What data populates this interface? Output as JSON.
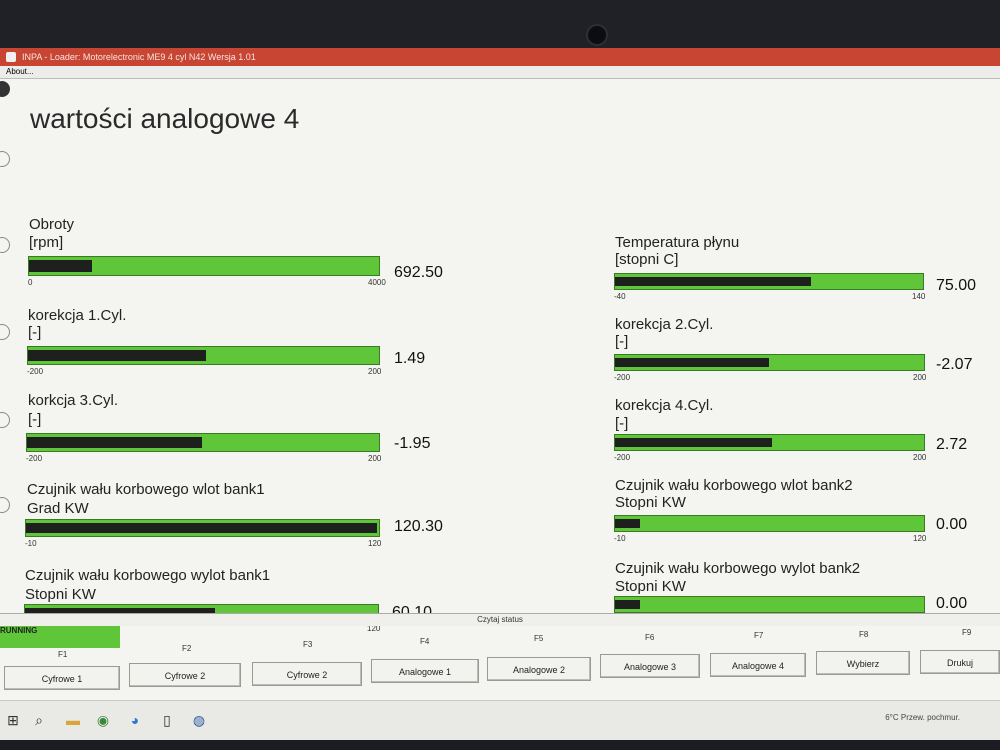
{
  "window": {
    "title": "INPA - Loader: Motorelectronic ME9  4 cyl N42 Wersja 1.01",
    "menu_about": "About..."
  },
  "page": {
    "title": "wartości analogowe 4"
  },
  "gauges": [
    {
      "name": "obroty",
      "label1": "Obroty",
      "label2": "[rpm]",
      "min": "0",
      "max": "4000",
      "value_text": "692.50",
      "fill": 0.18
    },
    {
      "name": "korekcja-1",
      "label1": "korekcja 1.Cyl.",
      "label2": "[-]",
      "min": "-200",
      "max": "200",
      "value_text": "1.49",
      "fill": 0.51
    },
    {
      "name": "korekcja-3",
      "label1": "korkcja 3.Cyl.",
      "label2": "[-]",
      "min": "-200",
      "max": "200",
      "value_text": "-1.95",
      "fill": 0.5
    },
    {
      "name": "wlot-bank1",
      "label1": "Czujnik wału korbowego wlot bank1",
      "label2": "Grad KW",
      "min": "-10",
      "max": "120",
      "value_text": "120.30",
      "fill": 1.0
    },
    {
      "name": "wylot-bank1",
      "label1": "Czujnik wału korbowego wylot bank1",
      "label2": "Stopni KW",
      "min": "-10",
      "max": "120",
      "value_text": "60.10",
      "fill": 0.54
    },
    {
      "name": "temperatura",
      "label1": "Temperatura płynu",
      "label2": "[stopni C]",
      "min": "-40",
      "max": "140",
      "value_text": "75.00",
      "fill": 0.64
    },
    {
      "name": "korekcja-2",
      "label1": "korekcja 2.Cyl.",
      "label2": "[-]",
      "min": "-200",
      "max": "200",
      "value_text": "-2.07",
      "fill": 0.5
    },
    {
      "name": "korekcja-4",
      "label1": "korekcja 4.Cyl.",
      "label2": "[-]",
      "min": "-200",
      "max": "200",
      "value_text": "2.72",
      "fill": 0.51
    },
    {
      "name": "wlot-bank2",
      "label1": "Czujnik wału korbowego wlot bank2",
      "label2": "Stopni KW",
      "min": "-10",
      "max": "120",
      "value_text": "0.00",
      "fill": 0.08
    },
    {
      "name": "wylot-bank2",
      "label1": "Czujnik wału korbowego wylot bank2",
      "label2": "Stopni KW",
      "min": "-10",
      "max": "120",
      "value_text": "0.00",
      "fill": 0.08
    }
  ],
  "status": {
    "center": "Czytaj status",
    "running": "RUNNING"
  },
  "fkeys": [
    {
      "key": "F1",
      "label": "Cyfrowe 1"
    },
    {
      "key": "F2",
      "label": "Cyfrowe 2"
    },
    {
      "key": "F3",
      "label": "Cyfrowe 2"
    },
    {
      "key": "F4",
      "label": "Analogowe 1"
    },
    {
      "key": "F5",
      "label": "Analogowe 2"
    },
    {
      "key": "F6",
      "label": "Analogowe 3"
    },
    {
      "key": "F7",
      "label": "Analogowe 4"
    },
    {
      "key": "F8",
      "label": "Wybierz"
    },
    {
      "key": "F9",
      "label": "Drukuj"
    }
  ],
  "taskbar": {
    "weather": "6°C  Przew. pochmur."
  },
  "colors": {
    "bar_green": "#5fc63a",
    "bar_dark": "#1e201e",
    "titlebar": "#c74532"
  }
}
